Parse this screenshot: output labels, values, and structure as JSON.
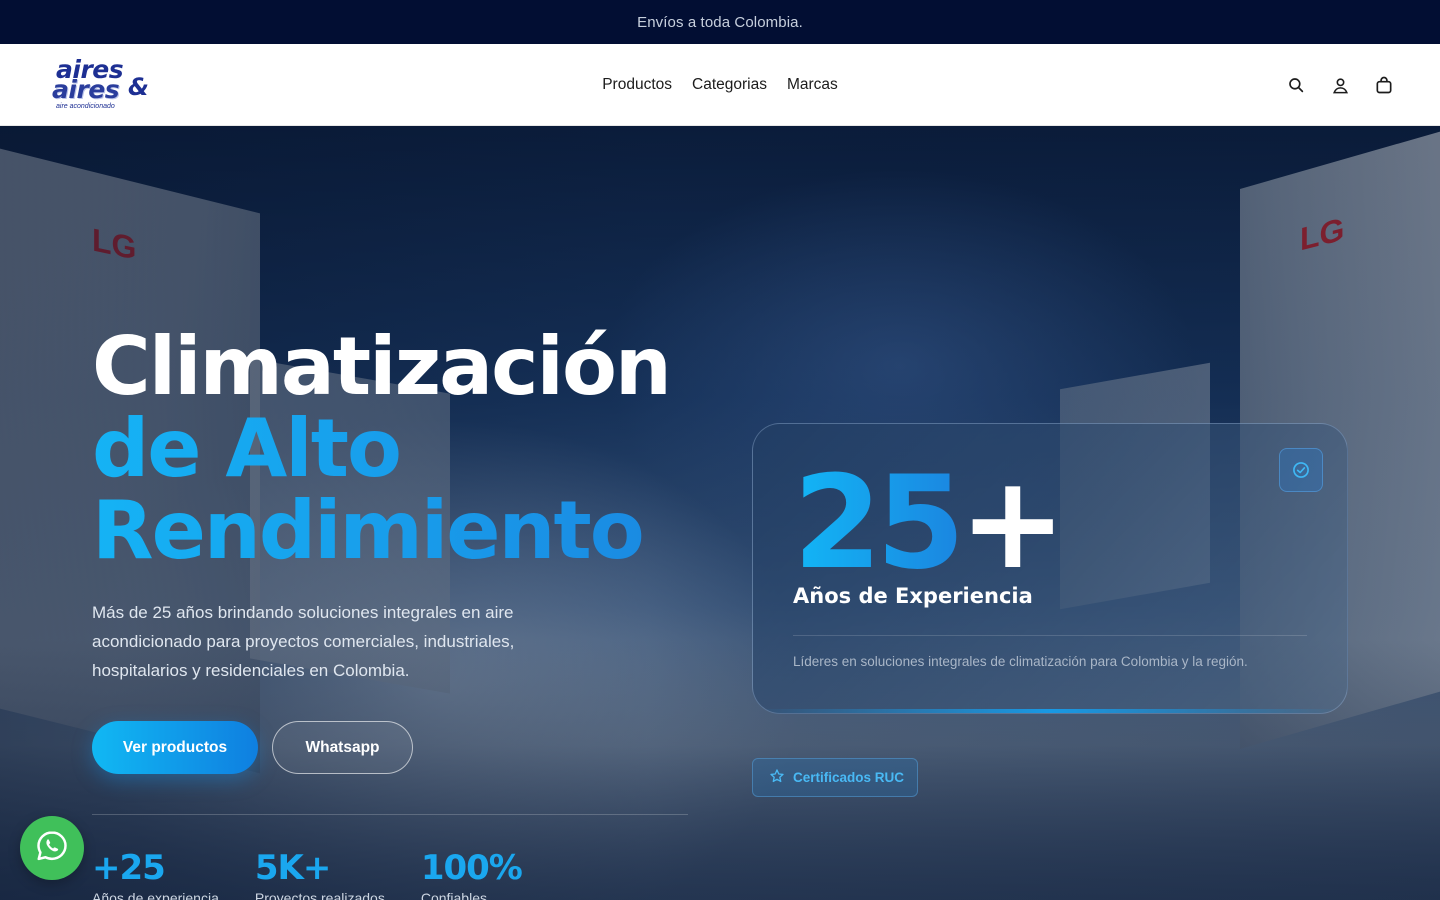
{
  "announcement": {
    "text": "Envíos a toda Colombia."
  },
  "brand": {
    "line1": "aires",
    "line2": "aires",
    "amp": "&",
    "tagline": "aire acondicionado"
  },
  "nav": {
    "items": [
      "Productos",
      "Categorias",
      "Marcas"
    ]
  },
  "header_icons": [
    "search-icon",
    "account-icon",
    "cart-icon"
  ],
  "hero": {
    "title_line1": "Climatización",
    "title_line2": "de Alto",
    "title_line3": "Rendimiento",
    "description": "Más de 25 años brindando soluciones integrales en aire acondicionado para proyectos comerciales, industriales, hospitalarios y residenciales en Colombia.",
    "primary_button": "Ver productos",
    "secondary_button": "Whatsapp",
    "background_labels": [
      "LG",
      "LG"
    ]
  },
  "stats": [
    {
      "value": "+25",
      "label": "Años de experiencia"
    },
    {
      "value": "5K+",
      "label": "Proyectos realizados"
    },
    {
      "value": "100%",
      "label": "Confiables"
    }
  ],
  "experience_card": {
    "number": "25",
    "plus": "+",
    "title": "Años de Experiencia",
    "subtitle": "Líderes en soluciones integrales de climatización para Colombia y la región."
  },
  "badge": {
    "label": "Certificados RUC"
  },
  "colors": {
    "accent": "#1aa7ef",
    "announcement_bg": "#020e33",
    "whatsapp": "#40c05a"
  }
}
